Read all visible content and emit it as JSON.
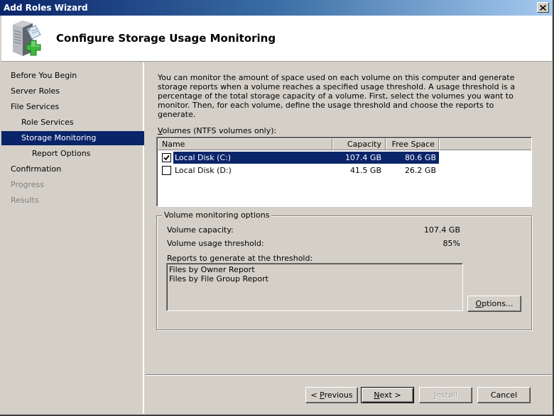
{
  "window": {
    "title": "Add Roles Wizard",
    "close_icon": "close-icon"
  },
  "header": {
    "title": "Configure Storage Usage Monitoring",
    "icon": "server-add-role-icon"
  },
  "sidebar": {
    "items": [
      {
        "label": "Before You Begin",
        "level": 0,
        "state": "normal"
      },
      {
        "label": "Server Roles",
        "level": 0,
        "state": "normal"
      },
      {
        "label": "File Services",
        "level": 0,
        "state": "normal"
      },
      {
        "label": "Role Services",
        "level": 1,
        "state": "normal"
      },
      {
        "label": "Storage Monitoring",
        "level": 1,
        "state": "active"
      },
      {
        "label": "Report Options",
        "level": 2,
        "state": "normal"
      },
      {
        "label": "Confirmation",
        "level": 0,
        "state": "normal"
      },
      {
        "label": "Progress",
        "level": 0,
        "state": "disabled"
      },
      {
        "label": "Results",
        "level": 0,
        "state": "disabled"
      }
    ]
  },
  "main": {
    "description": "You can monitor the amount of space used on each volume on this computer and generate storage reports when a volume reaches a specified usage threshold.  A usage threshold is a percentage of the total storage capacity of a volume. First, select the volumes you want to monitor.  Then, for each volume, define the usage threshold and choose the reports to generate.",
    "volumes_label_accel": "V",
    "volumes_label_rest": "olumes (NTFS volumes only):",
    "volumes_table": {
      "columns": [
        "Name",
        "Capacity",
        "Free Space"
      ],
      "rows": [
        {
          "name": "Local Disk (C:)",
          "capacity": "107.4 GB",
          "free_space": "80.6 GB",
          "checked": true,
          "selected": true
        },
        {
          "name": "Local Disk (D:)",
          "capacity": "41.5 GB",
          "free_space": "26.2 GB",
          "checked": false,
          "selected": false
        }
      ]
    },
    "monitoring_options": {
      "legend": "Volume monitoring options",
      "capacity_label": "Volume capacity:",
      "capacity_value": "107.4 GB",
      "threshold_label": "Volume usage threshold:",
      "threshold_value": "85%",
      "reports_label": "Reports to generate at the threshold:",
      "reports": [
        "Files by Owner Report",
        "Files by File Group Report"
      ],
      "options_button_accel": "O",
      "options_button_rest": "ptions..."
    }
  },
  "footer": {
    "previous_prefix": "< ",
    "previous_accel": "P",
    "previous_rest": "revious",
    "next_accel": "N",
    "next_rest": "ext >",
    "install_accel": "I",
    "install_rest": "nstall",
    "cancel_label": "Cancel"
  },
  "colors": {
    "selection": "#0a246a",
    "face": "#d4d0c8",
    "title_gradient_start": "#0a246a",
    "title_gradient_end": "#a6caf0",
    "plus_green": "#3cb83c"
  }
}
